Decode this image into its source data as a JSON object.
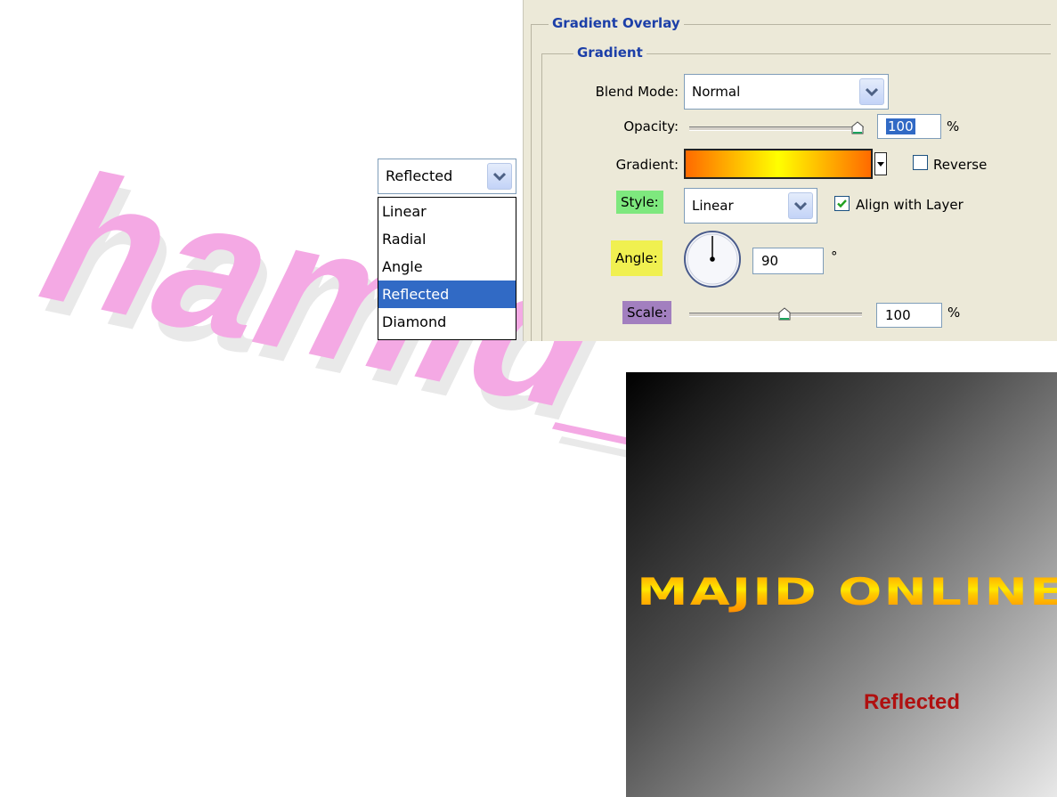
{
  "watermark": {
    "text": "hamid_",
    "color": "#f4a9e4"
  },
  "style_dropdown": {
    "selected": "Reflected",
    "options": [
      "Linear",
      "Radial",
      "Angle",
      "Reflected",
      "Diamond"
    ],
    "highlighted_index": 3
  },
  "panel": {
    "title": "Gradient Overlay",
    "group_title": "Gradient",
    "blend_mode": {
      "label": "Blend Mode:",
      "value": "Normal"
    },
    "opacity": {
      "label": "Opacity:",
      "value": "100",
      "unit": "%",
      "level": 1.0
    },
    "gradient": {
      "label": "Gradient:",
      "colors": [
        "#ff6a00",
        "#ffff00",
        "#ff6a00"
      ],
      "reverse_label": "Reverse",
      "reverse_checked": false
    },
    "style": {
      "label": "Style:",
      "value": "Linear",
      "tag_color": "#7ee87e",
      "align_label": "Align with Layer",
      "align_checked": true
    },
    "angle": {
      "label": "Angle:",
      "value": "90",
      "unit": "°",
      "tag_color": "#f0f050",
      "degrees": 90
    },
    "scale": {
      "label": "Scale:",
      "value": "100",
      "unit": "%",
      "tag_color": "#a27fbf",
      "level": 0.55
    }
  },
  "preview": {
    "headline": "MAJID ONLINE",
    "caption": "Reflected"
  }
}
